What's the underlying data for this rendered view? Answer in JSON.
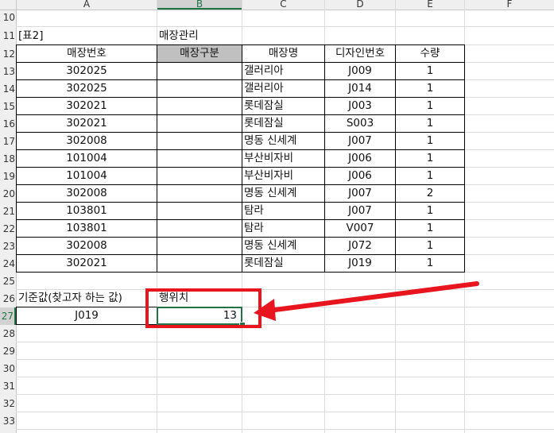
{
  "columns": [
    "A",
    "B",
    "C",
    "D",
    "E",
    "F"
  ],
  "rows": [
    "10",
    "11",
    "12",
    "13",
    "14",
    "15",
    "16",
    "17",
    "18",
    "19",
    "20",
    "21",
    "22",
    "23",
    "24",
    "25",
    "26",
    "27",
    "28",
    "29",
    "30",
    "31",
    "32",
    "33"
  ],
  "table_label": "[표2]",
  "table_title": "매장관리",
  "table": {
    "headers": [
      "매장번호",
      "매장구분",
      "매장명",
      "디자인번호",
      "수량"
    ],
    "rows": [
      [
        "302025",
        "",
        "갤러리아",
        "J009",
        "1"
      ],
      [
        "302025",
        "",
        "갤러리아",
        "J014",
        "1"
      ],
      [
        "302021",
        "",
        "롯데잠실",
        "J003",
        "1"
      ],
      [
        "302021",
        "",
        "롯데잠실",
        "S003",
        "1"
      ],
      [
        "302008",
        "",
        "명동 신세계",
        "J007",
        "1"
      ],
      [
        "101004",
        "",
        "부산비자비",
        "J006",
        "1"
      ],
      [
        "101004",
        "",
        "부산비자비",
        "J006",
        "1"
      ],
      [
        "302008",
        "",
        "명동 신세계",
        "J007",
        "2"
      ],
      [
        "103801",
        "",
        "탐라",
        "J007",
        "1"
      ],
      [
        "103801",
        "",
        "탐라",
        "V007",
        "1"
      ],
      [
        "302008",
        "",
        "명동 신세계",
        "J072",
        "1"
      ],
      [
        "302021",
        "",
        "롯데잠실",
        "J019",
        "1"
      ]
    ]
  },
  "lookup": {
    "label": "기준값(찾고자 하는 값)",
    "value": "J019",
    "result_label": "행위치",
    "result_value": "13"
  },
  "colors": {
    "header_fill_gray": "#c0c0c0",
    "annotation_red": "#e8141e",
    "selection_green": "#217346"
  }
}
